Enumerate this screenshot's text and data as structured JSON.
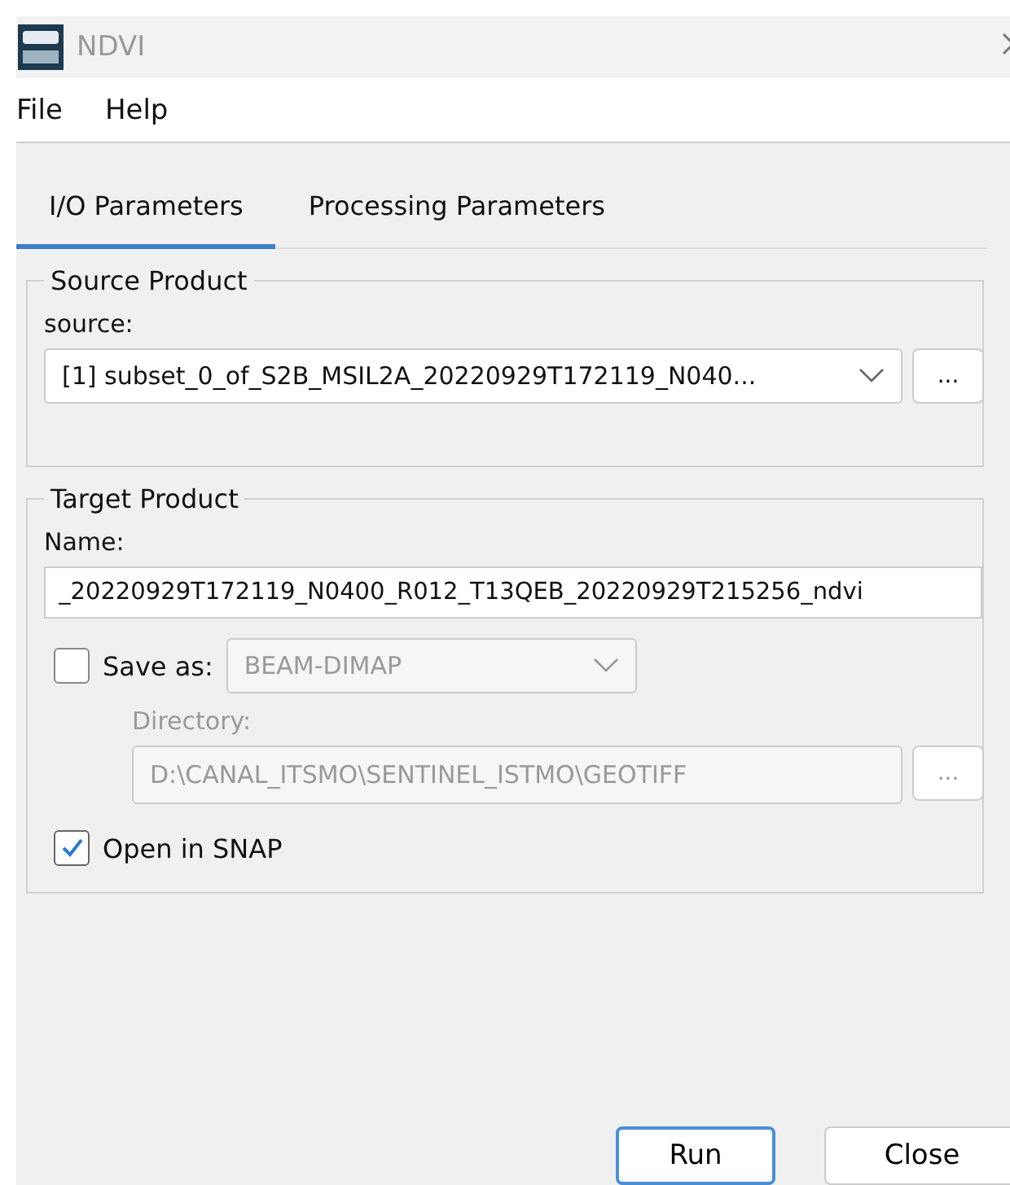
{
  "window": {
    "title": "NDVI"
  },
  "menu": [
    "File",
    "Help"
  ],
  "tabs": [
    {
      "label": "I/O Parameters",
      "selected": true
    },
    {
      "label": "Processing Parameters",
      "selected": false
    }
  ],
  "source_product": {
    "title": "Source Product",
    "label": "source:",
    "value": "[1] subset_0_of_S2B_MSIL2A_20220929T172119_N040...",
    "browse": "..."
  },
  "target_product": {
    "title": "Target Product",
    "name_label": "Name:",
    "name_value": "_20220929T172119_N0400_R012_T13QEB_20220929T215256_ndvi",
    "save_as": {
      "label": "Save as:",
      "checked": false,
      "format": "BEAM-DIMAP",
      "disabled": true
    },
    "directory": {
      "label": "Directory:",
      "value": "D:\\CANAL_ITSMO\\SENTINEL_ISTMO\\GEOTIFF",
      "browse": "...",
      "disabled": true
    },
    "open_in_snap": {
      "label": "Open in SNAP",
      "checked": true
    }
  },
  "buttons": [
    {
      "label": "Run",
      "selected": true
    },
    {
      "label": "Close",
      "selected": false
    }
  ]
}
